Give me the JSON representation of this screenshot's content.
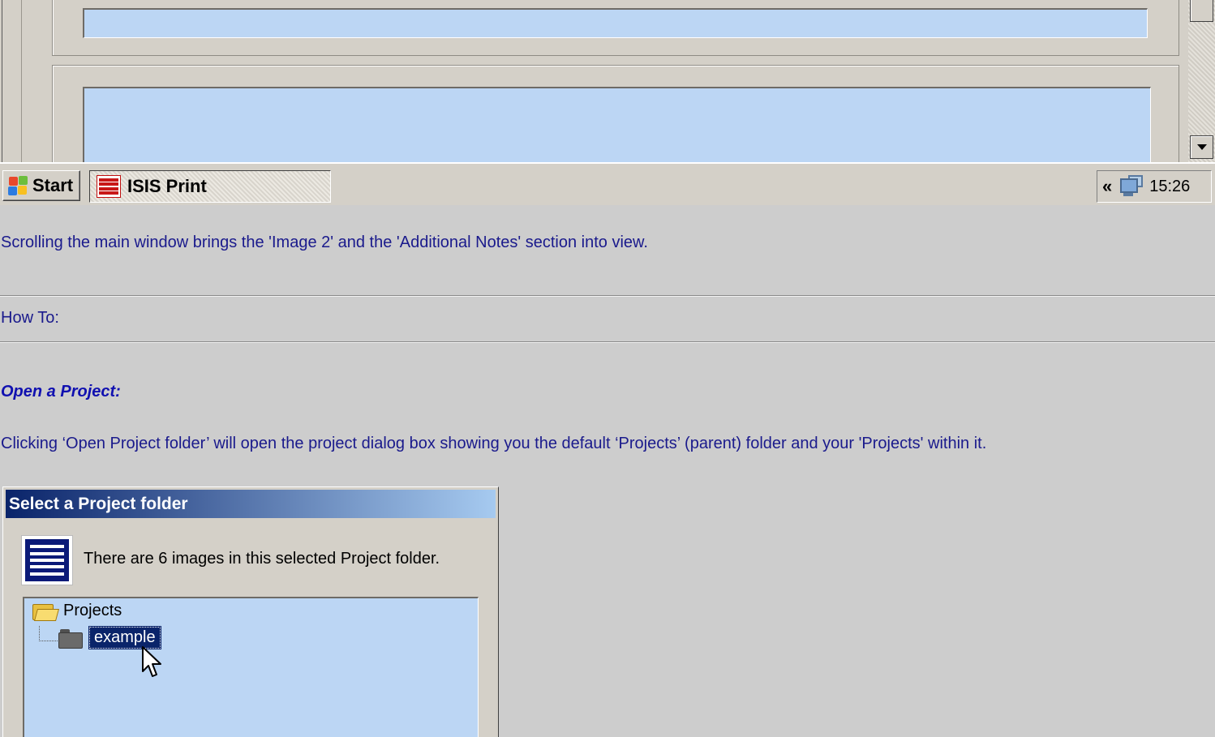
{
  "taskbar": {
    "start_label": "Start",
    "task_label": "ISIS Print",
    "tray_chevron": "«",
    "clock": "15:26"
  },
  "document": {
    "scroll_note": "Scrolling the main window brings the 'Image 2' and the 'Additional Notes' section into view.",
    "howto_label": "How To:",
    "open_heading": "Open a Project:",
    "open_paragraph": "Clicking ‘Open Project folder’ will open the project dialog box showing you the default ‘Projects’ (parent) folder and your 'Projects' within it."
  },
  "dialog": {
    "title": "Select a Project folder",
    "message": "There are 6 images in this selected Project folder.",
    "tree": {
      "root_label": "Projects",
      "child_label": "example"
    }
  },
  "icons": {
    "start": "windows-flag-icon",
    "task": "isis-print-icon",
    "tray": "network-icon",
    "root_folder": "folder-open-icon",
    "child_folder": "folder-closed-icon",
    "cursor": "mouse-pointer-icon"
  },
  "colors": {
    "document_text": "#1a1a8c",
    "field_blue": "#bcd6f4",
    "title_gradient_start": "#0a246a",
    "title_gradient_end": "#a6caf0",
    "selection": "#0a246a"
  }
}
